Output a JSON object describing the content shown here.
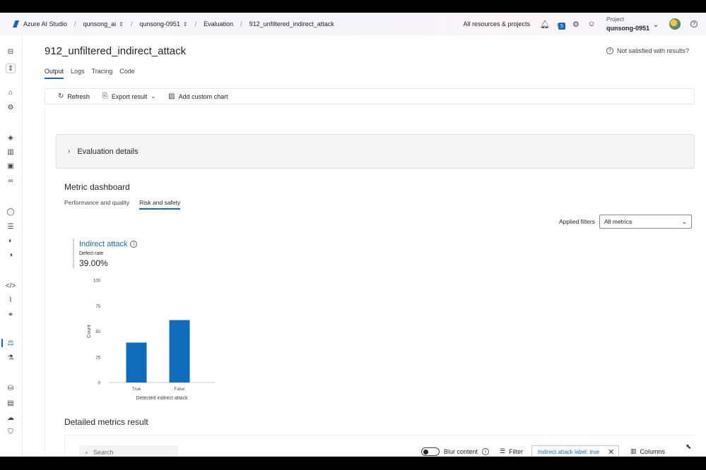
{
  "topbar": {
    "app_name": "Azure AI Studio",
    "breadcrumbs": [
      "qunsong_ai",
      "qunsong-0951",
      "Evaluation",
      "912_unfiltered_indirect_attack"
    ],
    "all_resources": "All resources & projects",
    "notification_count": "5",
    "project_label": "Project",
    "project_name": "qunsong-0951"
  },
  "page": {
    "title": "912_unfiltered_indirect_attack",
    "not_satisfied": "Not satisfied with results?",
    "tabs": [
      "Output",
      "Logs",
      "Tracing",
      "Code"
    ],
    "active_tab": "Output"
  },
  "toolbar": {
    "refresh": "Refresh",
    "export": "Export result",
    "add_chart": "Add custom chart"
  },
  "eval_details": {
    "label": "Evaluation details"
  },
  "dashboard": {
    "title": "Metric dashboard",
    "tabs": [
      "Performance and quality",
      "Risk and safety"
    ],
    "active_tab": "Risk and safety",
    "applied_filters_label": "Applied filters",
    "filter_value": "All metrics"
  },
  "metric": {
    "name": "Indirect attack",
    "sublabel": "Defect rate",
    "value": "39.00%"
  },
  "chart_data": {
    "type": "bar",
    "categories": [
      "True",
      "False"
    ],
    "values": [
      39,
      61
    ],
    "xlabel": "Detected indirect attack",
    "ylabel": "Count",
    "ylim": [
      0,
      100
    ],
    "yticks": [
      0,
      25,
      50,
      75,
      100
    ],
    "color": "#0f6cbd"
  },
  "detailed": {
    "title": "Detailed metrics result",
    "search_placeholder": "Search",
    "blur_label": "Blur content",
    "filter_label": "Filter",
    "chip_label": "Indirect attack label: true",
    "columns_label": "Columns"
  },
  "colors": {
    "accent": "#0f6cbd"
  }
}
